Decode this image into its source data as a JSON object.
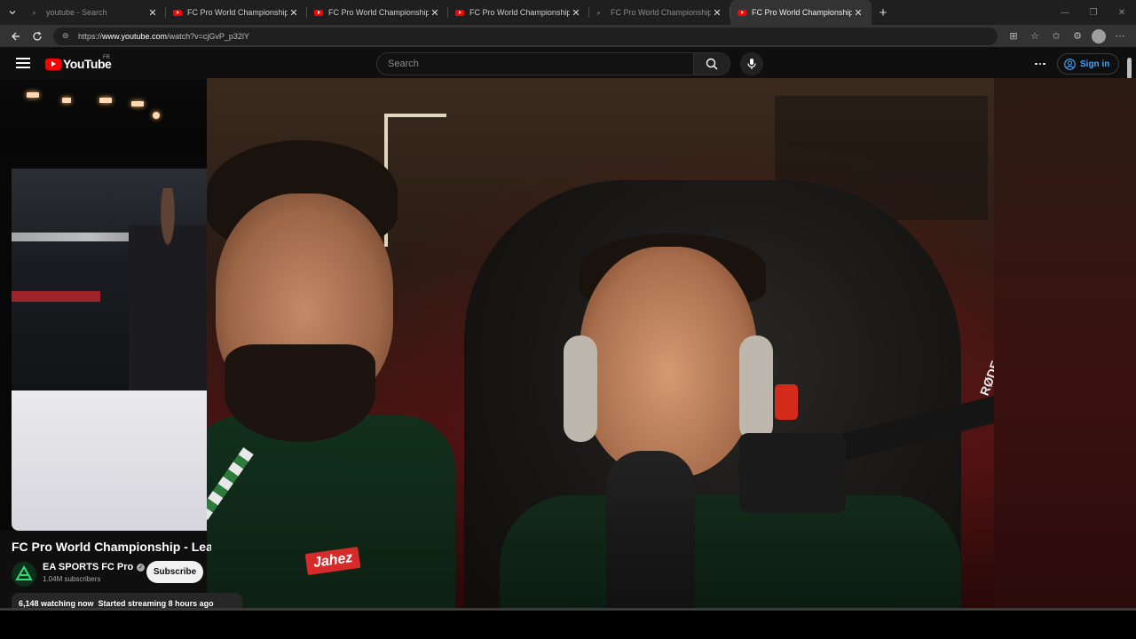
{
  "browser": {
    "tabs": [
      {
        "title": "youtube - Search",
        "favicon": "search-icon",
        "state": "dim"
      },
      {
        "title": "FC Pro World Championship - League",
        "favicon": "youtube-icon",
        "state": "normal"
      },
      {
        "title": "FC Pro World Championship - League",
        "favicon": "youtube-icon",
        "state": "normal"
      },
      {
        "title": "FC Pro World Championship - League",
        "favicon": "youtube-icon",
        "state": "normal"
      },
      {
        "title": "FC Pro World Championship - League",
        "favicon": "search-icon",
        "state": "dim"
      },
      {
        "title": "FC Pro World Championship - League",
        "favicon": "youtube-icon",
        "state": "active"
      }
    ],
    "url_prefix": "https://",
    "url_host": "www.youtube.com",
    "url_path": "/watch?v=cjGvP_p32lY"
  },
  "masthead": {
    "logo_text": "YouTube",
    "country_code": "FR",
    "search_placeholder": "Search",
    "signin_label": "Sign in"
  },
  "video": {
    "title": "FC Pro World Championship - League",
    "channel_name": "EA SPORTS FC Pro",
    "subscribers": "1.04M subscribers",
    "subscribe_label": "Subscribe",
    "watching": "6,148 watching now",
    "started": "Started streaming 8 hours ago"
  },
  "stream": {
    "sponsor_text": "Jahez",
    "mic_brand": "RØDE"
  },
  "colors": {
    "youtube_red": "#ff0000",
    "link_blue": "#3ea6ff",
    "background": "#0f0f0f"
  }
}
